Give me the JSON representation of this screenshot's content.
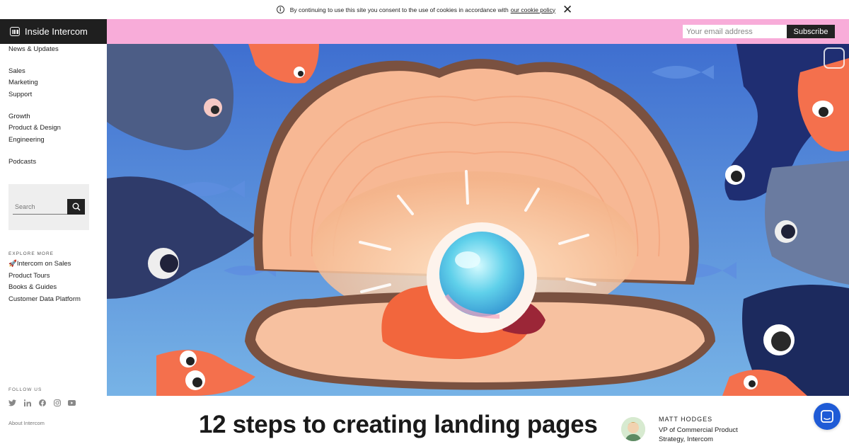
{
  "cookie_bar": {
    "text": "By continuing to use this site you consent to the use of cookies in accordance with",
    "link": "our cookie policy"
  },
  "brand": {
    "name": "Inside Intercom"
  },
  "nav": {
    "group1": [
      "News & Updates"
    ],
    "group2": [
      "Sales",
      "Marketing",
      "Support"
    ],
    "group3": [
      "Growth",
      "Product & Design",
      "Engineering"
    ],
    "group4": [
      "Podcasts"
    ]
  },
  "search": {
    "placeholder": "Search"
  },
  "explore": {
    "title": "EXPLORE MORE",
    "links": [
      "🚀Intercom on Sales",
      "Product Tours",
      "Books & Guides",
      "Customer Data Platform"
    ]
  },
  "follow": {
    "title": "FOLLOW US",
    "icons": [
      "twitter-icon",
      "linkedin-icon",
      "facebook-icon",
      "instagram-icon",
      "youtube-icon"
    ]
  },
  "about": "About Intercom",
  "subscribe": {
    "placeholder": "Your email address",
    "button": "Subscribe"
  },
  "article": {
    "title": "12 steps to creating landing pages",
    "author_name": "MATT HODGES",
    "author_role": "VP of Commercial Product Strategy, Intercom"
  },
  "colors": {
    "pink": "#f8acd9",
    "dark": "#1f1f1f",
    "chat_blue": "#1f5bd6",
    "sea": "#4f86d8"
  }
}
